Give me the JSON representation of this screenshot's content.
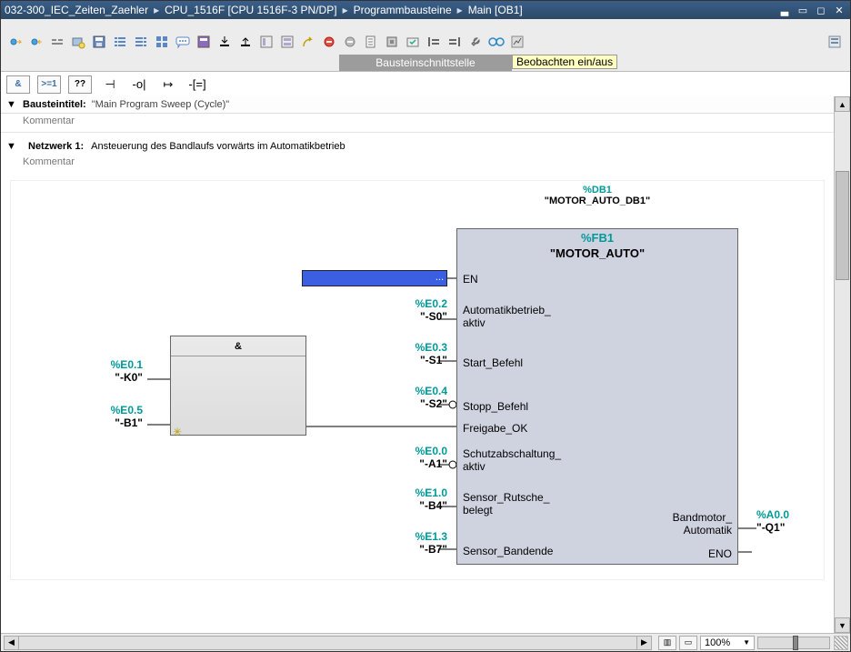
{
  "title": {
    "crumbs": [
      "032-300_IEC_Zeiten_Zaehler",
      "CPU_1516F [CPU 1516F-3 PN/DP]",
      "Programmbausteine",
      "Main [OB1]"
    ]
  },
  "interface_label": "Bausteinschnittstelle",
  "tooltip": "Beobachten ein/aus",
  "palette": {
    "and": "&",
    "cmp": ">=1",
    "box": "??",
    "a": "⊣",
    "b": "-o|",
    "c": "↦",
    "d": "-[=]"
  },
  "block_title_label": "Bausteintitel:",
  "block_title_value": "\"Main Program Sweep (Cycle)\"",
  "kommentar": "Kommentar",
  "network": {
    "label": "Netzwerk 1:",
    "desc": "Ansteuerung des Bandlaufs vorwärts im Automatikbetrieb"
  },
  "db": {
    "addr": "%DB1",
    "name": "\"MOTOR_AUTO_DB1\""
  },
  "fb": {
    "addr": "%FB1",
    "name": "\"MOTOR_AUTO\""
  },
  "and_hdr": "&",
  "and_inputs": [
    {
      "addr": "%E0.1",
      "sym": "\"-K0\""
    },
    {
      "addr": "%E0.5",
      "sym": "\"-B1\""
    }
  ],
  "fb_ports_left": [
    {
      "label": "EN"
    },
    {
      "addr": "%E0.2",
      "sym": "\"-S0\"",
      "label": "Automatikbetrieb_",
      "label2": "aktiv"
    },
    {
      "addr": "%E0.3",
      "sym": "\"-S1\"",
      "label": "Start_Befehl"
    },
    {
      "addr": "%E0.4",
      "sym": "\"-S2\"",
      "label": "Stopp_Befehl",
      "neg": true
    },
    {
      "label": "Freigabe_OK"
    },
    {
      "addr": "%E0.0",
      "sym": "\"-A1\"",
      "label": "Schutzabschaltung_",
      "label2": "aktiv",
      "neg": true
    },
    {
      "addr": "%E1.0",
      "sym": "\"-B4\"",
      "label": "Sensor_Rutsche_",
      "label2": "belegt"
    },
    {
      "addr": "%E1.3",
      "sym": "\"-B7\"",
      "label": "Sensor_Bandende"
    }
  ],
  "fb_ports_right": [
    {
      "addr": "%A0.0",
      "sym": "\"-Q1\"",
      "label": "Bandmotor_",
      "label2": "Automatik"
    },
    {
      "label": "ENO"
    }
  ],
  "zoom": "100%"
}
